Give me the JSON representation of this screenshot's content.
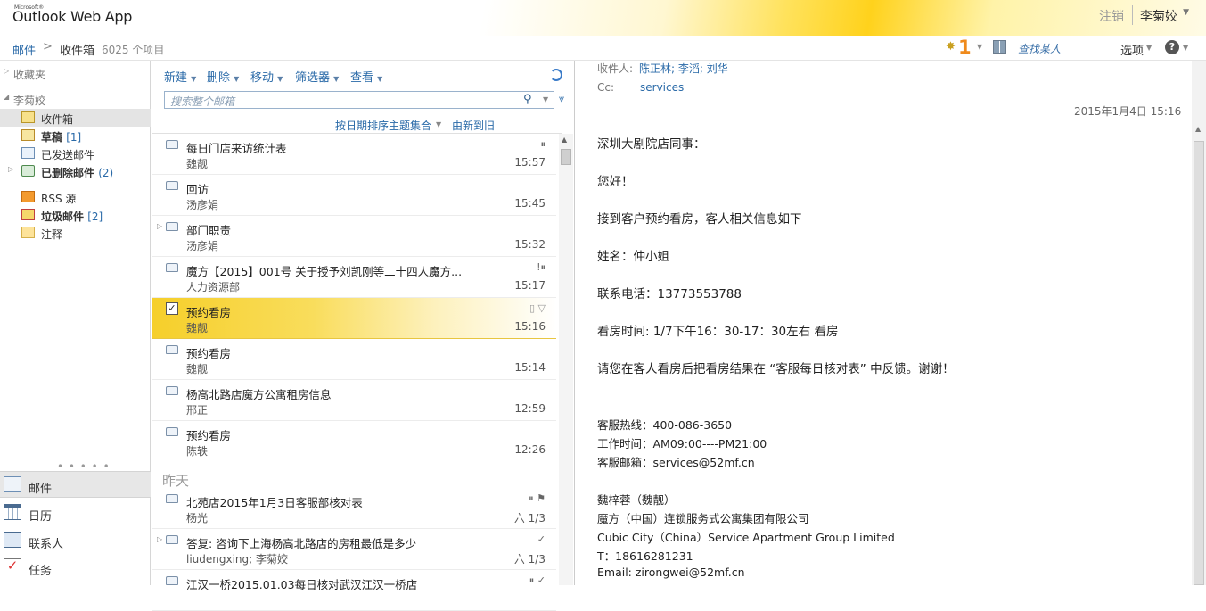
{
  "header": {
    "ms_label": "Microsoft®",
    "app_title": "Outlook Web App",
    "signout": "注销",
    "user_name": "李菊姣"
  },
  "breadcrumb": {
    "mail": "邮件",
    "separator": ">",
    "inbox": "收件箱",
    "count": "6025 个项目"
  },
  "topright": {
    "notification_count": "1",
    "find_people": "查找某人",
    "options": "选项",
    "help": "?"
  },
  "nav": {
    "favorites": "收藏夹",
    "account": "李菊姣",
    "folders": [
      {
        "label": "收件箱",
        "count": "",
        "icon": "inbox-icon"
      },
      {
        "label": "草稿",
        "count": "[1]",
        "icon": "drafts-icon"
      },
      {
        "label": "已发送邮件",
        "count": "",
        "icon": "sent-icon"
      },
      {
        "label": "已删除邮件",
        "count": "(2)",
        "icon": "trash-icon"
      },
      {
        "label": "RSS 源",
        "count": "",
        "icon": "rss-icon"
      },
      {
        "label": "垃圾邮件",
        "count": "[2]",
        "icon": "junk-icon"
      },
      {
        "label": "注释",
        "count": "",
        "icon": "notes-icon"
      }
    ],
    "modules": [
      {
        "label": "邮件",
        "icon": "mail-icon"
      },
      {
        "label": "日历",
        "icon": "calendar-icon"
      },
      {
        "label": "联系人",
        "icon": "contacts-icon"
      },
      {
        "label": "任务",
        "icon": "tasks-icon"
      }
    ]
  },
  "toolbar": {
    "new": "新建",
    "delete": "删除",
    "move": "移动",
    "filter": "筛选器",
    "view": "查看",
    "search_placeholder": "搜索整个邮箱",
    "sort_label": "按日期排序主题集合",
    "sort_order": "由新到旧"
  },
  "messages": [
    {
      "subject": "每日门店来访统计表",
      "from": "魏靓",
      "time": "15:57",
      "flags": "⏸"
    },
    {
      "subject": "回访",
      "from": "汤彦娟",
      "time": "15:45",
      "flags": ""
    },
    {
      "subject": "部门职责",
      "from": "汤彦娟",
      "time": "15:32",
      "flags": ""
    },
    {
      "subject": "魔方【2015】001号 关于授予刘凯刚等二十四人魔方...",
      "from": "人力资源部",
      "time": "15:17",
      "flags": "!⏸"
    },
    {
      "subject": "预约看房",
      "from": "魏靓",
      "time": "15:16",
      "flags": "▯ ▽"
    },
    {
      "subject": "预约看房",
      "from": "魏靓",
      "time": "15:14",
      "flags": ""
    },
    {
      "subject": "杨高北路店魔方公寓租房信息",
      "from": "邢正",
      "time": "12:59",
      "flags": ""
    },
    {
      "subject": "预约看房",
      "from": "陈轶",
      "time": "12:26",
      "flags": ""
    }
  ],
  "yesterday_header": "昨天",
  "messages_yesterday": [
    {
      "subject": "北苑店2015年1月3日客服部核对表",
      "from": "杨光",
      "time": "六 1/3",
      "flags": "⏸ ⚑"
    },
    {
      "subject": "答复: 咨询下上海杨高北路店的房租最低是多少",
      "from": "liudengxing; 李菊姣",
      "time": "六 1/3",
      "flags": "✓"
    },
    {
      "subject": "江汉一桥2015.01.03每日核对武汉江汉一桥店",
      "from": "",
      "time": "",
      "flags": "⏸ ✓"
    }
  ],
  "reading": {
    "to_label": "收件人:",
    "to_value": "陈正林; 李滔; 刘华",
    "cc_label": "Cc:",
    "cc_value": "services",
    "date": "2015年1月4日 15:16",
    "body": [
      "深圳大剧院店同事：",
      "您好！",
      "接到客户预约看房，客人相关信息如下",
      "姓名：仲小姐",
      "联系电话：13773553788",
      "看房时间: 1/7下午16：30-17：30左右 看房",
      "请您在客人看房后把看房结果在 “客服每日核对表” 中反馈。谢谢！"
    ],
    "signature": [
      "客服热线：400-086-3650",
      "工作时间：AM09:00----PM21:00",
      "客服邮箱：services@52mf.cn",
      "魏梓蓉（魏靓）",
      "魔方（中国）连锁服务式公寓集团有限公司",
      "Cubic City（China）Service Apartment Group Limited",
      "T：18616281231",
      "Email: zirongwei@52mf.cn"
    ]
  }
}
